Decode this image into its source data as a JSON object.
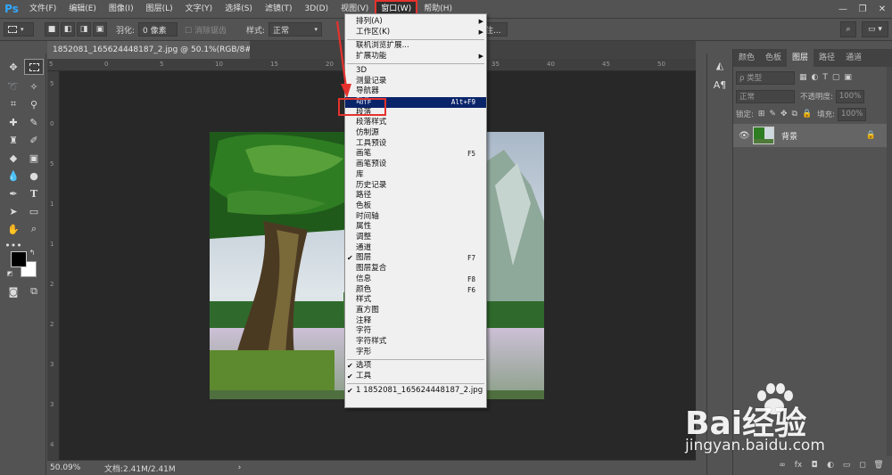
{
  "app": {
    "logo": "Ps",
    "menus": [
      "文件(F)",
      "编辑(E)",
      "图像(I)",
      "图层(L)",
      "文字(Y)",
      "选择(S)",
      "滤镜(T)",
      "3D(D)",
      "视图(V)",
      "窗口(W)",
      "帮助(H)"
    ],
    "active_menu": "窗口(W)",
    "win_controls": [
      "—",
      "❐",
      "✕"
    ]
  },
  "options": {
    "feather_label": "羽化:",
    "feather_value": "0 像素",
    "antialias_label": "消除锯齿",
    "style_label": "样式:",
    "style_value": "正常",
    "select_mask_label": "选择并遮住..."
  },
  "document": {
    "tab_title": "1852081_165624448187_2.jpg @ 50.1%(RGB/8#)",
    "close": "×"
  },
  "rulers": {
    "top": [
      "5",
      "0",
      "5",
      "10",
      "15",
      "20",
      "25",
      "30",
      "35",
      "40",
      "45",
      "50"
    ],
    "left": [
      "5",
      "0",
      "5",
      "1",
      "1",
      "2",
      "2",
      "3",
      "3",
      "4"
    ]
  },
  "status": {
    "zoom": "50.09%",
    "doc_info": "文档:2.41M/2.41M",
    "arrow": "›"
  },
  "window_menu": {
    "items": [
      {
        "label": "排列(A)",
        "submenu": true
      },
      {
        "label": "工作区(K)",
        "submenu": true
      },
      {
        "sep": true
      },
      {
        "label": "联机浏览扩展..."
      },
      {
        "label": "扩展功能",
        "submenu": true
      },
      {
        "sep": true
      },
      {
        "label": "3D"
      },
      {
        "label": "测量记录"
      },
      {
        "label": "导航器"
      },
      {
        "label": "动作",
        "shortcut": "Alt+F9",
        "highlight": true
      },
      {
        "label": "段落"
      },
      {
        "label": "段落样式"
      },
      {
        "label": "仿制源"
      },
      {
        "label": "工具预设"
      },
      {
        "label": "画笔",
        "shortcut": "F5"
      },
      {
        "label": "画笔预设"
      },
      {
        "label": "库"
      },
      {
        "label": "历史记录"
      },
      {
        "label": "路径"
      },
      {
        "label": "色板"
      },
      {
        "label": "时间轴"
      },
      {
        "label": "属性"
      },
      {
        "label": "调整"
      },
      {
        "label": "通道"
      },
      {
        "label": "图层",
        "shortcut": "F7",
        "checked": true
      },
      {
        "label": "图层复合"
      },
      {
        "label": "信息",
        "shortcut": "F8"
      },
      {
        "label": "颜色",
        "shortcut": "F6"
      },
      {
        "label": "样式"
      },
      {
        "label": "直方图"
      },
      {
        "label": "注释"
      },
      {
        "label": "字符"
      },
      {
        "label": "字符样式"
      },
      {
        "label": "字形"
      },
      {
        "sep": true
      },
      {
        "label": "选项",
        "checked": true
      },
      {
        "label": "工具",
        "checked": true
      },
      {
        "sep": true
      },
      {
        "label": "1 1852081_165624448187_2.jpg",
        "checked": true
      }
    ]
  },
  "layers_panel": {
    "tabs": [
      "颜色",
      "色板",
      "图层",
      "路径",
      "通道"
    ],
    "active_tab": "图层",
    "filter_label": "ρ 类型",
    "blend_mode": "正常",
    "opacity_label": "不透明度:",
    "opacity_value": "100%",
    "lock_label": "锁定:",
    "fill_label": "填充:",
    "fill_value": "100%",
    "layer_name": "背景",
    "bottom_buttons": [
      "∞",
      "fx",
      "◘",
      "◐",
      "▭",
      "◻",
      "🗑"
    ]
  },
  "watermark": {
    "brand": "Bai经验",
    "url": "jingyan.baidu.com"
  },
  "colors": {
    "accent_red": "#e5322d",
    "menu_highlight": "#0a246a",
    "ps_blue": "#31a8ff"
  }
}
